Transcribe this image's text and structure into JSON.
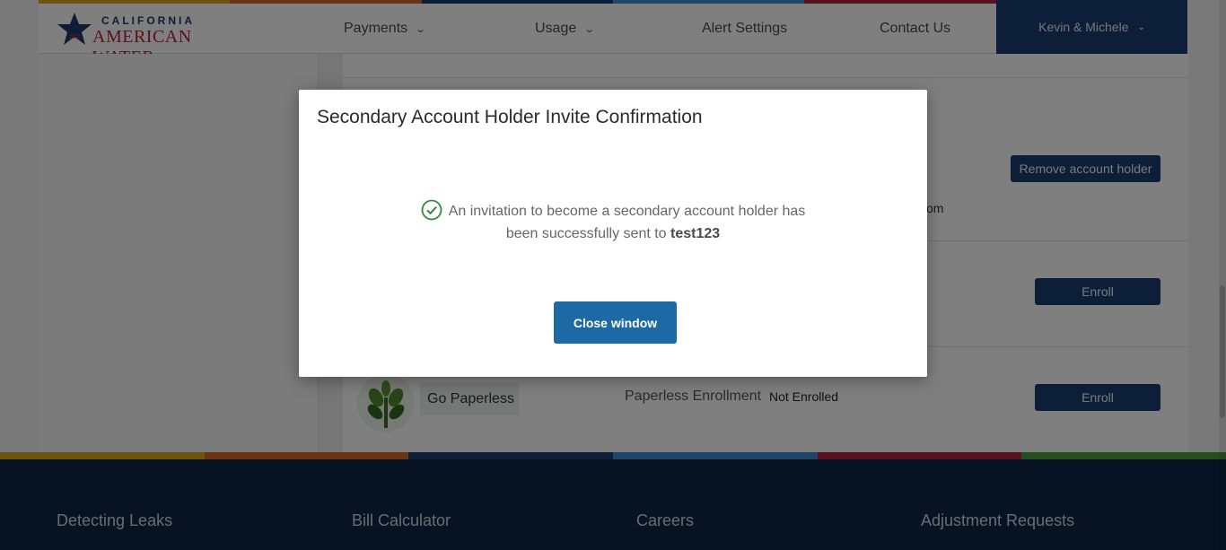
{
  "brand": {
    "line1": "CALIFORNIA",
    "line2": "AMERICAN WATER"
  },
  "nav": {
    "payments": "Payments",
    "usage": "Usage",
    "alert_settings": "Alert Settings",
    "contact_us": "Contact Us",
    "user": "Kevin & Michele"
  },
  "main": {
    "remove_holder_label": "Remove account holder",
    "email_fragment": "om",
    "enroll_label": "Enroll",
    "paperless": {
      "title": "Go Paperless",
      "enrollment_label": "Paperless Enrollment",
      "status": "Not Enrolled",
      "enroll_label": "Enroll"
    }
  },
  "modal": {
    "title": "Secondary Account Holder Invite Confirmation",
    "message": "An invitation to become a secondary account holder has been successfully sent to",
    "recipient": "test123",
    "close_label": "Close window"
  },
  "footer": {
    "columns": [
      "Detecting Leaks",
      "Bill Calculator",
      "Careers",
      "Adjustment Requests"
    ]
  },
  "colors": {
    "accent_blue": "#1b6aa6",
    "nav_dark": "#1b3f70",
    "footer_bg": "#0e2644",
    "success_green": "#2e8b3d",
    "stripe": [
      "#d8a91e",
      "#d0682a",
      "#1b3f70",
      "#3f8ad0",
      "#b0243b",
      "#4c9a3a"
    ]
  }
}
